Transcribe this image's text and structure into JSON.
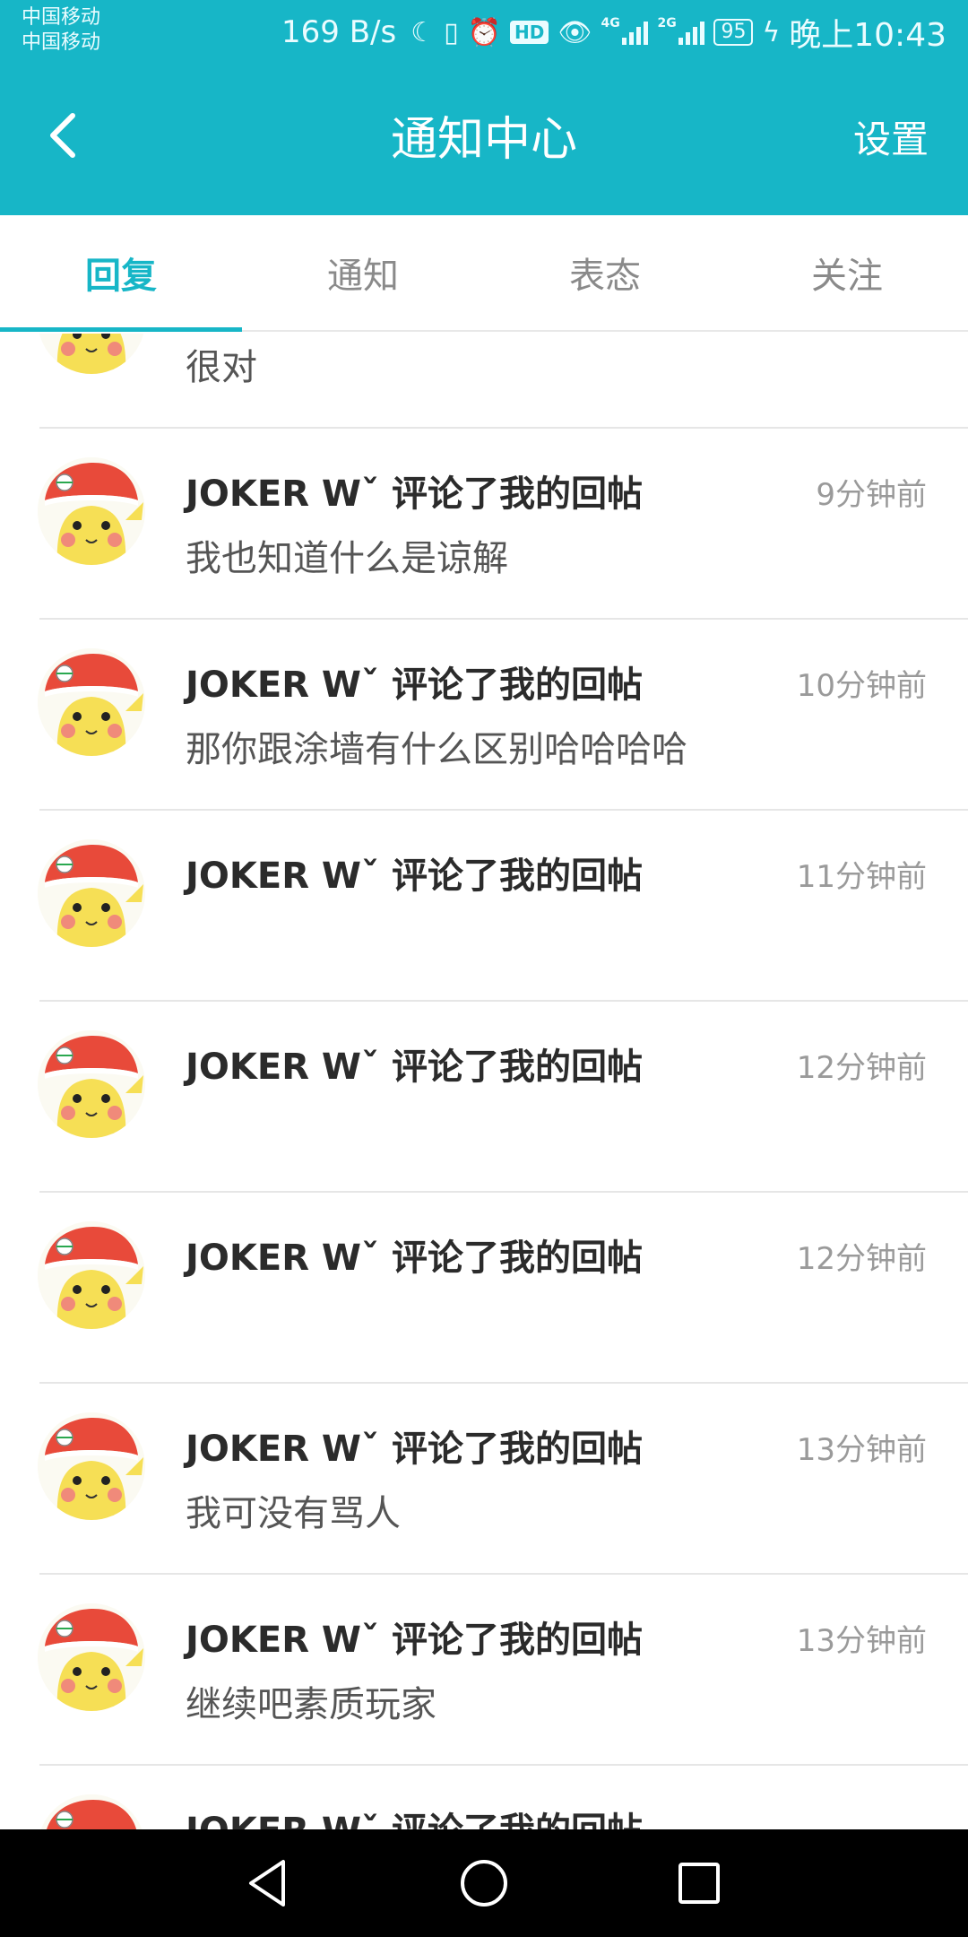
{
  "status_bar": {
    "carrier_1": "中国移动",
    "carrier_2": "中国移动",
    "net_speed": "169 B/s",
    "sig1_gen": "4G",
    "sig2_gen": "2G",
    "hd_label": "HD",
    "battery": "95",
    "clock": "晚上10:43"
  },
  "header": {
    "title": "通知中心",
    "settings_label": "设置"
  },
  "tabs": [
    {
      "label": "回复",
      "active": true
    },
    {
      "label": "通知",
      "active": false
    },
    {
      "label": "表态",
      "active": false
    },
    {
      "label": "关注",
      "active": false
    }
  ],
  "notifications": [
    {
      "title": "",
      "time": "",
      "content": "很对"
    },
    {
      "title": "JOKER Wˇ 评论了我的回帖",
      "time": "9分钟前",
      "content": "我也知道什么是谅解"
    },
    {
      "title": "JOKER Wˇ 评论了我的回帖",
      "time": "10分钟前",
      "content": "那你跟涂墙有什么区别哈哈哈哈"
    },
    {
      "title": "JOKER Wˇ 评论了我的回帖",
      "time": "11分钟前",
      "content": ""
    },
    {
      "title": "JOKER Wˇ 评论了我的回帖",
      "time": "12分钟前",
      "content": ""
    },
    {
      "title": "JOKER Wˇ 评论了我的回帖",
      "time": "12分钟前",
      "content": ""
    },
    {
      "title": "JOKER Wˇ 评论了我的回帖",
      "time": "13分钟前",
      "content": "我可没有骂人"
    },
    {
      "title": "JOKER Wˇ 评论了我的回帖",
      "time": "13分钟前",
      "content": "继续吧素质玩家"
    },
    {
      "title": "JOKER Wˇ 评论了我的回帖",
      "time": "",
      "content": ""
    }
  ],
  "colors": {
    "accent": "#17b6c7",
    "title_text": "#2b2b2b",
    "secondary_text": "#9a9a9a",
    "nav_bar": "#000000"
  },
  "icons": {
    "back": "chevron-left-icon",
    "nav_back": "triangle-back-icon",
    "nav_home": "circle-home-icon",
    "nav_recent": "square-recent-icon"
  }
}
